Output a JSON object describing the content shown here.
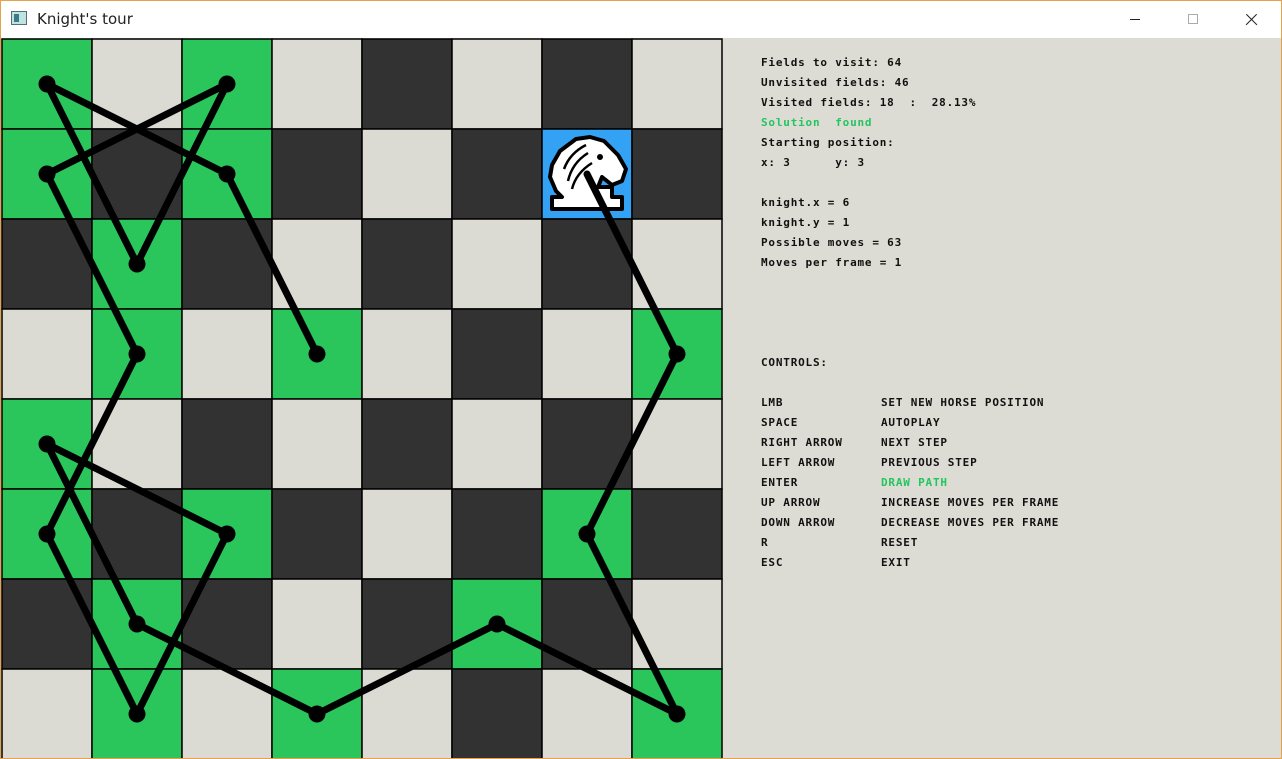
{
  "window": {
    "title": "Knight's tour",
    "icon": "app-window-icon"
  },
  "board": {
    "size": 8,
    "colors": {
      "light": "#dcdbd3",
      "dark": "#323232",
      "visited": "#2ac65b",
      "current": "#33a2f5",
      "path": "#000000"
    },
    "visited_cells": [
      [
        0,
        0
      ],
      [
        2,
        0
      ],
      [
        0,
        1
      ],
      [
        2,
        1
      ],
      [
        1,
        2
      ],
      [
        1,
        3
      ],
      [
        3,
        3
      ],
      [
        7,
        3
      ],
      [
        0,
        4
      ],
      [
        0,
        5
      ],
      [
        2,
        5
      ],
      [
        6,
        5
      ],
      [
        1,
        6
      ],
      [
        5,
        6
      ],
      [
        1,
        7
      ],
      [
        3,
        7
      ],
      [
        7,
        7
      ]
    ],
    "current_cell": [
      6,
      1
    ],
    "path": [
      [
        6,
        1
      ],
      [
        7,
        3
      ],
      [
        6,
        5
      ],
      [
        7,
        7
      ],
      [
        5,
        6
      ],
      [
        3,
        7
      ],
      [
        1,
        6
      ],
      [
        0,
        4
      ],
      [
        2,
        5
      ],
      [
        1,
        7
      ],
      [
        0,
        5
      ],
      [
        1,
        3
      ],
      [
        0,
        1
      ],
      [
        2,
        0
      ],
      [
        1,
        2
      ],
      [
        0,
        0
      ],
      [
        2,
        1
      ],
      [
        3,
        3
      ]
    ],
    "knight_icon": "knight-chess-icon"
  },
  "info": {
    "fields_to_visit": "Fields to visit: 64",
    "unvisited_fields": "Unvisited fields: 46",
    "visited_fields": "Visited fields: 18  :  28.13%",
    "solution_status": "Solution  found",
    "starting_position_label": "Starting position:",
    "starting_xy": "x: 3      y: 3",
    "knight_x": "knight.x = 6",
    "knight_y": "knight.y = 1",
    "possible_moves": "Possible moves = 63",
    "moves_per_frame": "Moves per frame = 1",
    "status_color": "#22c55e"
  },
  "controls": {
    "heading": "CONTROLS:",
    "items": [
      {
        "key": "LMB",
        "action": "SET NEW HORSE POSITION"
      },
      {
        "key": "SPACE",
        "action": "AUTOPLAY"
      },
      {
        "key": "RIGHT ARROW",
        "action": "NEXT STEP"
      },
      {
        "key": "LEFT ARROW",
        "action": "PREVIOUS STEP"
      },
      {
        "key": "ENTER",
        "action": "DRAW PATH",
        "highlight": true
      },
      {
        "key": "UP ARROW",
        "action": "INCREASE MOVES PER FRAME"
      },
      {
        "key": "DOWN ARROW",
        "action": "DECREASE MOVES PER FRAME"
      },
      {
        "key": "R",
        "action": "RESET"
      },
      {
        "key": "ESC",
        "action": "EXIT"
      }
    ]
  }
}
